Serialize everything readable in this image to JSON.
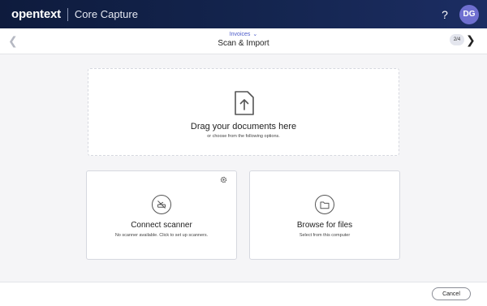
{
  "header": {
    "brand": "opentext",
    "product": "Core Capture",
    "help_label": "?",
    "avatar_initials": "DG",
    "background_color": "#0e1b3d",
    "avatar_color": "#6f6fd0"
  },
  "subbar": {
    "breadcrumb": "Invoices",
    "title": "Scan & Import",
    "step": "2/4",
    "back_icon": "chevron-left-icon",
    "next_icon": "chevron-right-icon"
  },
  "dropzone": {
    "icon": "upload-file-icon",
    "title": "Drag your documents here",
    "subtitle": "or choose from the following options."
  },
  "options": {
    "scanner": {
      "icon": "scanner-off-icon",
      "title": "Connect scanner",
      "subtitle": "No scanner available. Click to set up scanners.",
      "settings_icon": "gear-icon"
    },
    "browse": {
      "icon": "folder-icon",
      "title": "Browse for files",
      "subtitle": "Select from this computer"
    }
  },
  "footer": {
    "cancel_label": "Cancel"
  }
}
